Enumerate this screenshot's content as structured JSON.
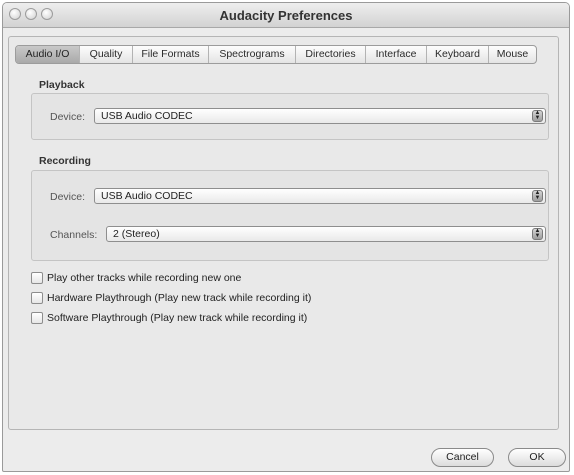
{
  "window": {
    "title": "Audacity Preferences"
  },
  "tabs": [
    {
      "label": "Audio I/O",
      "active": true
    },
    {
      "label": "Quality"
    },
    {
      "label": "File Formats"
    },
    {
      "label": "Spectrograms"
    },
    {
      "label": "Directories"
    },
    {
      "label": "Interface"
    },
    {
      "label": "Keyboard"
    },
    {
      "label": "Mouse"
    }
  ],
  "playback": {
    "section_label": "Playback",
    "device_label": "Device:",
    "device_value": "USB Audio CODEC"
  },
  "recording": {
    "section_label": "Recording",
    "device_label": "Device:",
    "device_value": "USB Audio CODEC",
    "channels_label": "Channels:",
    "channels_value": "2 (Stereo)"
  },
  "options": [
    {
      "label": "Play other tracks while recording new one",
      "checked": false
    },
    {
      "label": "Hardware Playthrough (Play new track while recording it)",
      "checked": false
    },
    {
      "label": "Software Playthrough (Play new track while recording it)",
      "checked": false
    }
  ],
  "buttons": {
    "cancel": "Cancel",
    "ok": "OK"
  }
}
